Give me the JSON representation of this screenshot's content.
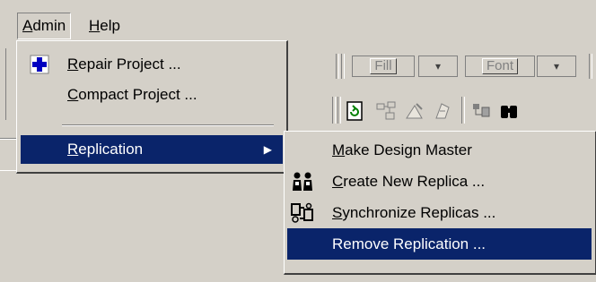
{
  "menubar": {
    "items": [
      {
        "label": "Admin",
        "accel": "A",
        "rest": "dmin"
      },
      {
        "label": "Help",
        "accel": "H",
        "rest": "elp"
      }
    ]
  },
  "toolbar": {
    "fill_label": "Fill",
    "font_label": "Font",
    "dropdown_arrow": "▾"
  },
  "admin_menu": {
    "items": [
      {
        "label": "Repair Project ...",
        "accel": "R",
        "rest": "epair Project ...",
        "icon": "plus-icon"
      },
      {
        "label": "Compact Project ...",
        "accel": "C",
        "rest": "ompact Project ..."
      },
      {
        "label": "Replication",
        "accel": "R",
        "rest": "eplication",
        "submenu_arrow": "▶",
        "highlighted": true
      }
    ]
  },
  "replication_menu": {
    "items": [
      {
        "label": "Make Design Master",
        "accel": "M",
        "rest": "ake Design Master"
      },
      {
        "label": "Create New Replica ...",
        "accel": "C",
        "rest": "reate New Replica ...",
        "icon": "create-replica-icon"
      },
      {
        "label": "Synchronize Replicas ...",
        "accel": "S",
        "rest": "ynchronize Replicas ...",
        "icon": "synchronize-icon"
      },
      {
        "label": "Remove Replication ...",
        "highlighted": true
      }
    ]
  },
  "colors": {
    "face": "#d4d0c8",
    "highlight": "#0a246a",
    "highlight_text": "#ffffff",
    "shadow": "#808080"
  }
}
